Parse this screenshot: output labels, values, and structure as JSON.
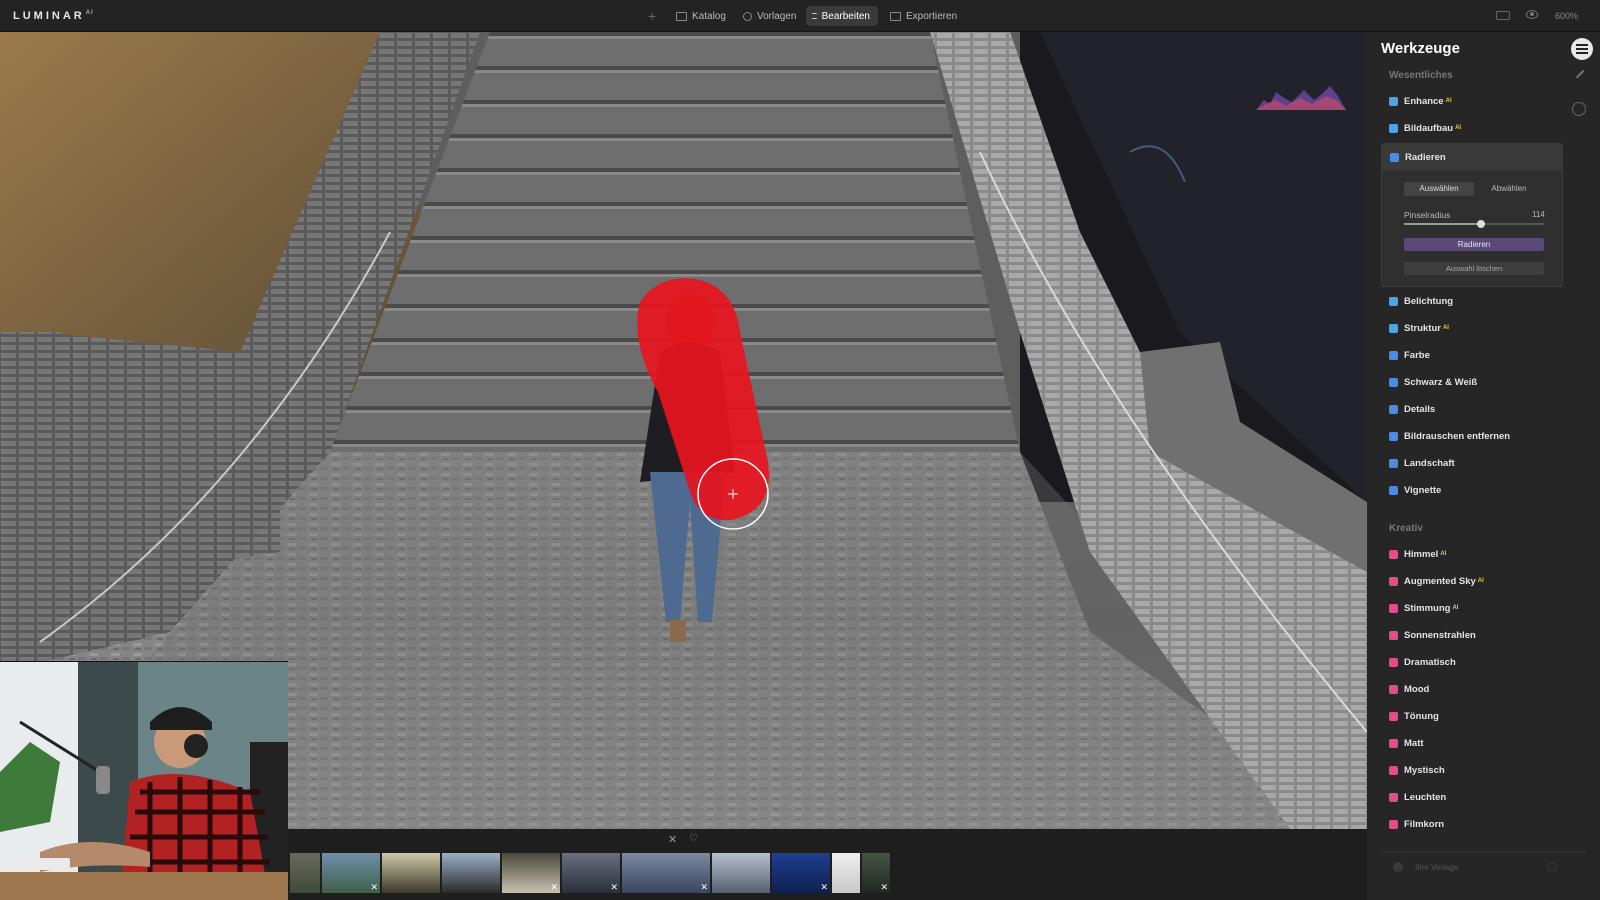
{
  "app": {
    "logo_text": "LUMINAR",
    "logo_suffix": "AI"
  },
  "topbar": {
    "tabs": [
      {
        "label": "Katalog",
        "active": false
      },
      {
        "label": "Vorlagen",
        "active": false
      },
      {
        "label": "Bearbeiten",
        "active": true
      },
      {
        "label": "Exportieren",
        "active": false
      }
    ],
    "zoom": "600%"
  },
  "sidebar": {
    "title": "Werkzeuge",
    "section_essentials": "Wesentliches",
    "section_creative": "Kreativ",
    "essentials": [
      {
        "label": "Enhance",
        "badge": "AI",
        "color": "#4aa6e8"
      },
      {
        "label": "Bildaufbau",
        "badge": "AI",
        "color": "#4aa6e8"
      },
      {
        "label": "Radieren",
        "badge": "",
        "color": "#4a8be8"
      },
      {
        "label": "Belichtung",
        "badge": "",
        "color": "#4aa6e8"
      },
      {
        "label": "Struktur",
        "badge": "AI",
        "color": "#4aa6e8"
      },
      {
        "label": "Farbe",
        "badge": "",
        "color": "#4a8be8"
      },
      {
        "label": "Schwarz & Weiß",
        "badge": "",
        "color": "#4a8be8"
      },
      {
        "label": "Details",
        "badge": "",
        "color": "#4a8be8"
      },
      {
        "label": "Bildrauschen entfernen",
        "badge": "",
        "color": "#4a8be8"
      },
      {
        "label": "Landschaft",
        "badge": "",
        "color": "#4a8be8"
      },
      {
        "label": "Vignette",
        "badge": "",
        "color": "#4a8be8"
      }
    ],
    "creative": [
      {
        "label": "Himmel",
        "badge": "AI",
        "color": "#e84a8a"
      },
      {
        "label": "Augmented Sky",
        "badge": "AI",
        "color": "#e84a8a"
      },
      {
        "label": "Stimmung",
        "badge": "AI",
        "color": "#e84a8a"
      },
      {
        "label": "Sonnenstrahlen",
        "badge": "",
        "color": "#e84a8a"
      },
      {
        "label": "Dramatisch",
        "badge": "",
        "color": "#e84a8a"
      },
      {
        "label": "Mood",
        "badge": "",
        "color": "#e84a8a"
      },
      {
        "label": "Tönung",
        "badge": "",
        "color": "#e84a8a"
      },
      {
        "label": "Matt",
        "badge": "",
        "color": "#e84a8a"
      },
      {
        "label": "Mystisch",
        "badge": "",
        "color": "#e84a8a"
      },
      {
        "label": "Leuchten",
        "badge": "",
        "color": "#e84a8a"
      },
      {
        "label": "Filmkorn",
        "badge": "",
        "color": "#e84a8a"
      }
    ],
    "erase_panel": {
      "select_label": "Auswählen",
      "deselect_label": "Abwählen",
      "brush_label": "Pinselradius",
      "brush_value": "114",
      "brush_fraction": 0.55,
      "erase_button": "Radieren",
      "clear_button": "Auswahl löschen"
    },
    "footer_label": "Ihre Vorlage"
  },
  "filmstrip": {
    "thumbs": [
      {
        "c1": "#6a6a5a",
        "c2": "#3e4a3a",
        "x": false
      },
      {
        "c1": "#6f8faa",
        "c2": "#3f5f4a",
        "x": true
      },
      {
        "c1": "#cfc8a8",
        "c2": "#3a3a2a",
        "x": false
      },
      {
        "c1": "#9ab0c8",
        "c2": "#2a2a2a",
        "x": false
      },
      {
        "c1": "#4a4a3a",
        "c2": "#c8c0b0",
        "x": true
      },
      {
        "c1": "#6a6f80",
        "c2": "#2a2f3a",
        "x": true
      },
      {
        "c1": "#7a8aa0",
        "c2": "#3a4560",
        "x": true
      },
      {
        "c1": "#b8c0cc",
        "c2": "#556070",
        "x": false
      },
      {
        "c1": "#1f3f90",
        "c2": "#0f1f50",
        "x": true
      },
      {
        "c1": "#f0f0f0",
        "c2": "#c8c8c8",
        "x": false
      },
      {
        "c1": "#445544",
        "c2": "#222822",
        "x": true
      }
    ]
  },
  "colors": {
    "accent": "#5a4a78",
    "mask": "#e8141e"
  }
}
